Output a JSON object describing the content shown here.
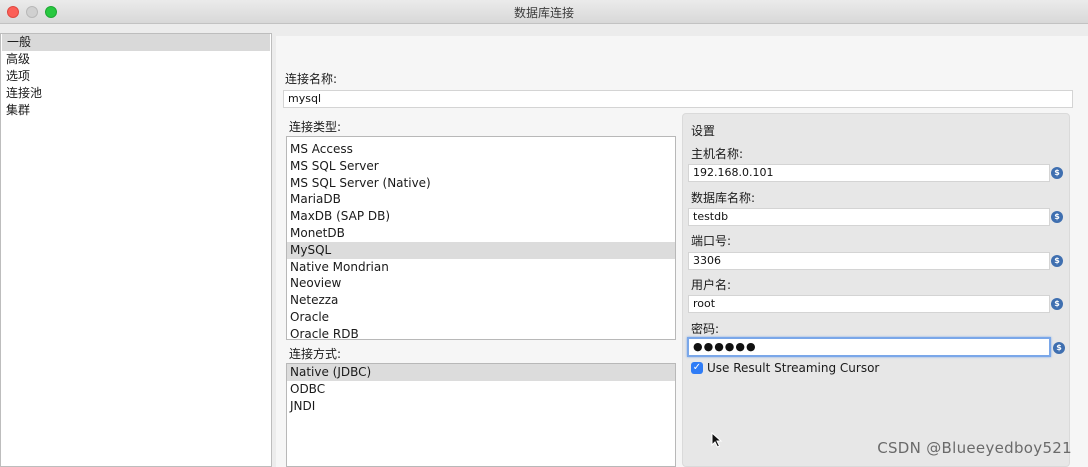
{
  "window": {
    "title": "数据库连接"
  },
  "nav": {
    "items": [
      "一般",
      "高级",
      "选项",
      "连接池",
      "集群"
    ],
    "selected": 0
  },
  "connection_name": {
    "label": "连接名称:",
    "value": "mysql"
  },
  "connection_type": {
    "label": "连接类型:",
    "items": [
      "MS Access",
      "MS SQL Server",
      "MS SQL Server (Native)",
      "MariaDB",
      "MaxDB (SAP DB)",
      "MonetDB",
      "MySQL",
      "Native Mondrian",
      "Neoview",
      "Netezza",
      "Oracle",
      "Oracle RDB"
    ],
    "selected": 6
  },
  "access": {
    "label": "连接方式:",
    "items": [
      "Native (JDBC)",
      "ODBC",
      "JNDI"
    ],
    "selected": 0
  },
  "settings": {
    "title": "设置",
    "host_label": "主机名称:",
    "host": "192.168.0.101",
    "db_label": "数据库名称:",
    "db": "testdb",
    "port_label": "端口号:",
    "port": "3306",
    "user_label": "用户名:",
    "user": "root",
    "password_label": "密码:",
    "password": "●●●●●●",
    "streaming_label": "Use Result Streaming Cursor",
    "streaming_checked": true
  },
  "icons": {
    "variable": "$"
  },
  "watermark": "CSDN @Blueeyedboy521"
}
